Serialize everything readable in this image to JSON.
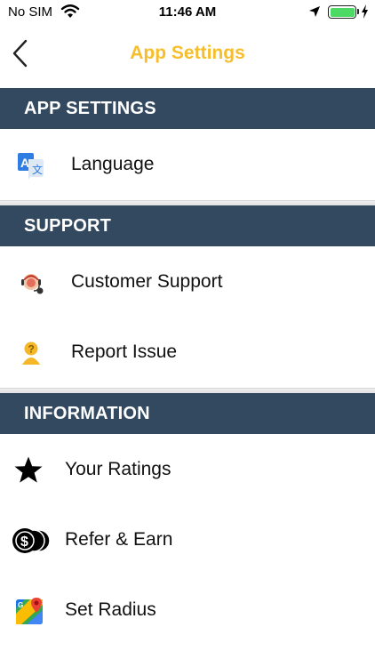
{
  "status_bar": {
    "carrier": "No SIM",
    "time": "11:46 AM",
    "battery_level": 1.0,
    "icons": [
      "wifi-icon",
      "location-arrow-icon",
      "battery-icon",
      "charging-bolt-icon"
    ]
  },
  "nav": {
    "title": "App Settings",
    "back_icon": "chevron-left-icon"
  },
  "colors": {
    "accent": "#f6be2c",
    "section_header_bg": "#334960",
    "section_header_text": "#ffffff"
  },
  "sections": [
    {
      "title": "APP SETTINGS",
      "items": [
        {
          "label": "Language",
          "icon": "translate-icon"
        }
      ]
    },
    {
      "title": "SUPPORT",
      "items": [
        {
          "label": "Customer Support",
          "icon": "headset-agent-icon"
        },
        {
          "label": "Report Issue",
          "icon": "question-person-icon"
        }
      ]
    },
    {
      "title": "INFORMATION",
      "items": [
        {
          "label": "Your Ratings",
          "icon": "star-icon"
        },
        {
          "label": "Refer & Earn",
          "icon": "coins-icon"
        },
        {
          "label": "Set Radius",
          "icon": "maps-icon"
        }
      ]
    }
  ]
}
